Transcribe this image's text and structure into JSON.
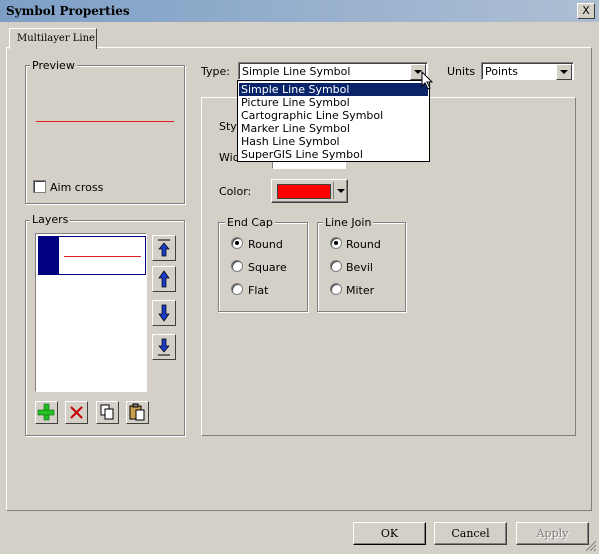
{
  "window": {
    "title": "Symbol Properties",
    "close_label": "X"
  },
  "tabs": [
    {
      "label": "Multilayer Line"
    }
  ],
  "preview": {
    "label": "Preview",
    "line_color": "#e02020",
    "aim_cross_label": "Aim cross",
    "aim_cross_checked": false
  },
  "layers": {
    "label": "Layers",
    "selected_color": "#000080",
    "line_color": "#e02020"
  },
  "type_field": {
    "label": "Type:",
    "value": "Simple Line Symbol"
  },
  "units_field": {
    "label": "Units",
    "value": "Points"
  },
  "type_dropdown": {
    "options": [
      "Simple Line Symbol",
      "Picture Line Symbol",
      "Cartographic Line Symbol",
      "Marker Line Symbol",
      "Hash Line Symbol",
      "SuperGIS Line Symbol"
    ],
    "selected_index": 0
  },
  "properties": {
    "style_label": "Styl",
    "width_label": "Wid",
    "color_label": "Color:",
    "color_value": "#ff0000",
    "end_cap": {
      "label": "End Cap",
      "options": [
        "Round",
        "Square",
        "Flat"
      ],
      "selected": "Round"
    },
    "line_join": {
      "label": "Line Join",
      "options": [
        "Round",
        "Bevil",
        "Miter"
      ],
      "selected": "Round"
    }
  },
  "footer": {
    "ok_label": "OK",
    "cancel_label": "Cancel",
    "apply_label": "Apply"
  }
}
